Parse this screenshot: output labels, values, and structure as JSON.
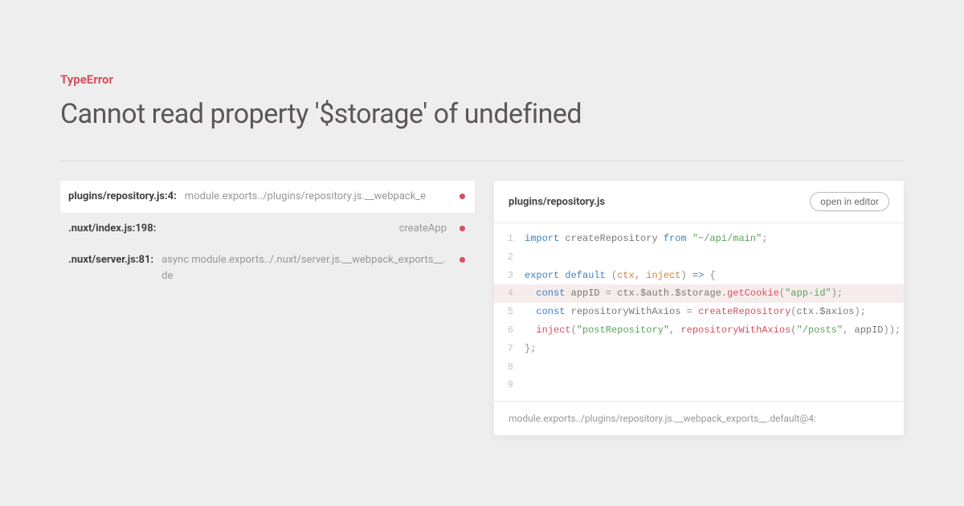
{
  "error": {
    "type": "TypeError",
    "message": "Cannot read property '$storage' of undefined"
  },
  "stack": [
    {
      "file": "plugins/repository.js:4:",
      "method": "module.exports../plugins/repository.js.__webpack_e",
      "active": true
    },
    {
      "file": ".nuxt/index.js:198:",
      "method": "createApp",
      "active": false
    },
    {
      "file": ".nuxt/server.js:81:",
      "method": "async module.exports../.nuxt/server.js.__webpack_exports__.de",
      "active": false
    }
  ],
  "code": {
    "file": "plugins/repository.js",
    "open_label": "open in editor",
    "highlight_line": 4,
    "footer": "module.exports../plugins/repository.js.__webpack_exports__.default@4:",
    "lines": [
      {
        "n": 1,
        "tokens": [
          {
            "t": "import ",
            "c": "kw"
          },
          {
            "t": "createRepository ",
            "c": "def"
          },
          {
            "t": "from ",
            "c": "kw"
          },
          {
            "t": "\"~/api/main\"",
            "c": "str"
          },
          {
            "t": ";",
            "c": "pun"
          }
        ]
      },
      {
        "n": 2,
        "tokens": []
      },
      {
        "n": 3,
        "tokens": [
          {
            "t": "export default ",
            "c": "kw"
          },
          {
            "t": "(",
            "c": "pun"
          },
          {
            "t": "ctx",
            "c": "fn"
          },
          {
            "t": ", ",
            "c": "pun"
          },
          {
            "t": "inject",
            "c": "fn"
          },
          {
            "t": ") ",
            "c": "pun"
          },
          {
            "t": "=>",
            "c": "var"
          },
          {
            "t": " {",
            "c": "pun"
          }
        ]
      },
      {
        "n": 4,
        "tokens": [
          {
            "t": "  ",
            "c": "pun"
          },
          {
            "t": "const ",
            "c": "kw"
          },
          {
            "t": "appID ",
            "c": "def"
          },
          {
            "t": "= ",
            "c": "pun"
          },
          {
            "t": "ctx",
            "c": "def"
          },
          {
            "t": ".",
            "c": "pun"
          },
          {
            "t": "$auth",
            "c": "def"
          },
          {
            "t": ".",
            "c": "pun"
          },
          {
            "t": "$storage",
            "c": "def"
          },
          {
            "t": ".",
            "c": "pun"
          },
          {
            "t": "getCookie",
            "c": "call"
          },
          {
            "t": "(",
            "c": "pun"
          },
          {
            "t": "\"app-id\"",
            "c": "str"
          },
          {
            "t": ");",
            "c": "pun"
          }
        ]
      },
      {
        "n": 5,
        "tokens": [
          {
            "t": "  ",
            "c": "pun"
          },
          {
            "t": "const ",
            "c": "kw"
          },
          {
            "t": "repositoryWithAxios ",
            "c": "def"
          },
          {
            "t": "= ",
            "c": "pun"
          },
          {
            "t": "createRepository",
            "c": "call"
          },
          {
            "t": "(",
            "c": "pun"
          },
          {
            "t": "ctx",
            "c": "def"
          },
          {
            "t": ".",
            "c": "pun"
          },
          {
            "t": "$axios",
            "c": "def"
          },
          {
            "t": ");",
            "c": "pun"
          }
        ]
      },
      {
        "n": 6,
        "tokens": [
          {
            "t": "  ",
            "c": "pun"
          },
          {
            "t": "inject",
            "c": "call"
          },
          {
            "t": "(",
            "c": "pun"
          },
          {
            "t": "\"postRepository\"",
            "c": "str"
          },
          {
            "t": ", ",
            "c": "pun"
          },
          {
            "t": "repositoryWithAxios",
            "c": "call"
          },
          {
            "t": "(",
            "c": "pun"
          },
          {
            "t": "\"/posts\"",
            "c": "str"
          },
          {
            "t": ", ",
            "c": "pun"
          },
          {
            "t": "appID",
            "c": "def"
          },
          {
            "t": "));",
            "c": "pun"
          }
        ]
      },
      {
        "n": 7,
        "tokens": [
          {
            "t": "};",
            "c": "pun"
          }
        ]
      },
      {
        "n": 8,
        "tokens": []
      },
      {
        "n": 9,
        "tokens": []
      }
    ]
  }
}
